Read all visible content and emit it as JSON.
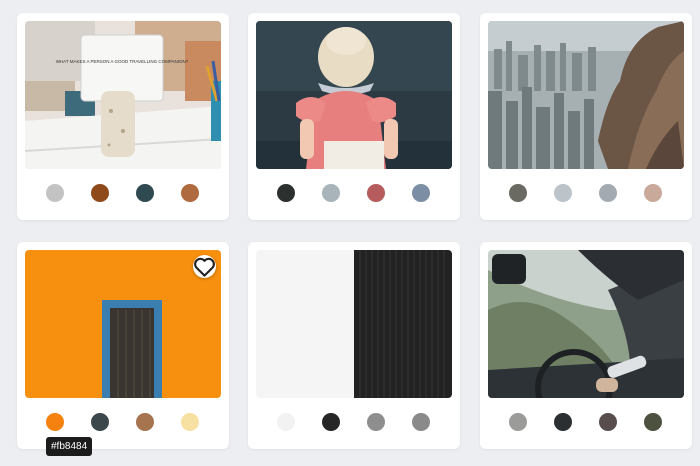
{
  "cards": [
    {
      "photo": "tabletop-card-holder",
      "sign_text": "WHAT MAKES A PERSON A GOOD TRAVELLING COMPANION?",
      "swatches": [
        "#c3c3c3",
        "#8f4a1c",
        "#2f4a50",
        "#b06a40"
      ]
    },
    {
      "photo": "girl-in-pink-dress",
      "swatches": [
        "#2c302e",
        "#a9b4ba",
        "#b65c5c",
        "#7b8ea3"
      ]
    },
    {
      "photo": "city-and-rock-cliff",
      "swatches": [
        "#6a6a62",
        "#bcc3c9",
        "#a3aab2",
        "#c9a99a"
      ]
    },
    {
      "photo": "blue-door-orange-wall",
      "swatches": [
        "#f5820e",
        "#3c474b",
        "#a6744f",
        "#f7e1a2"
      ],
      "favorite_icon": "heart-icon"
    },
    {
      "photo": "black-white-panel",
      "swatches": [
        "#f2f2f2",
        "#262626",
        "#8e8e8e",
        "#8a8a8a"
      ]
    },
    {
      "photo": "car-interior-steering-wheel",
      "swatches": [
        "#9b9b99",
        "#2b2f32",
        "#584d4d",
        "#4d513f"
      ]
    }
  ],
  "tooltip": {
    "text": "#fb8484"
  }
}
